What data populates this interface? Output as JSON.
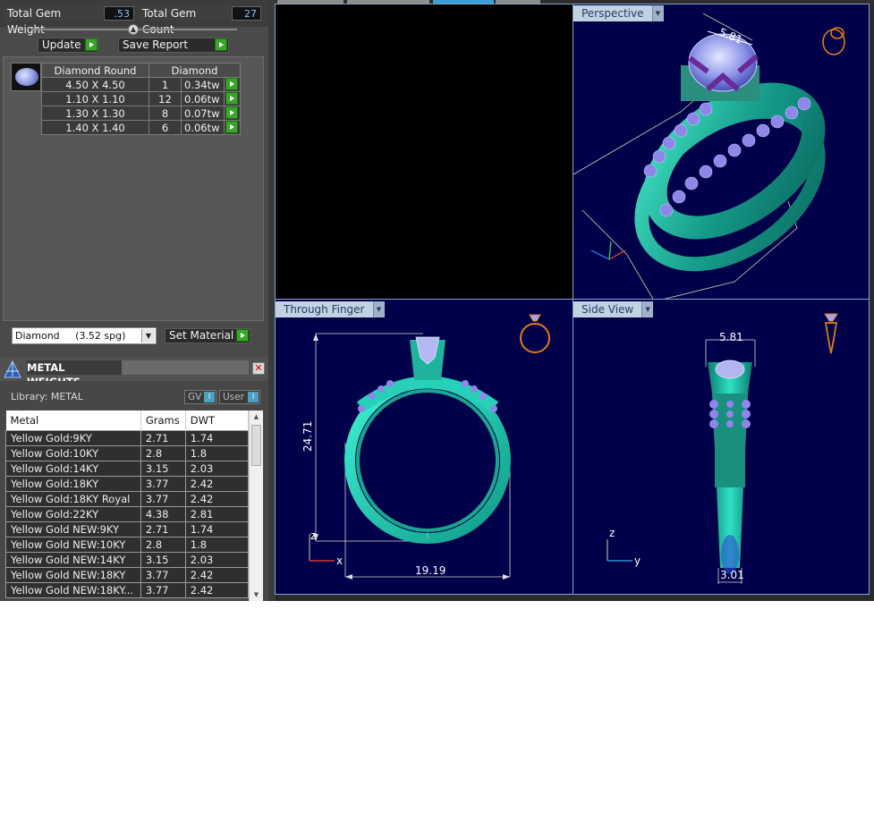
{
  "stats": {
    "total_weight_label": "Total Gem Weight",
    "total_weight_value": ".53",
    "total_count_label": "Total Gem Count",
    "total_count_value": "27"
  },
  "actions": {
    "update_label": "Update",
    "save_report_label": "Save Report"
  },
  "gem_table": {
    "headers": [
      "Diamond Round",
      "Diamond"
    ],
    "rows": [
      {
        "size": "4.50 X 4.50",
        "count": "1",
        "weight": "0.34tw"
      },
      {
        "size": "1.10 X 1.10",
        "count": "12",
        "weight": "0.06tw"
      },
      {
        "size": "1.30 X 1.30",
        "count": "8",
        "weight": "0.07tw"
      },
      {
        "size": "1.40 X 1.40",
        "count": "6",
        "weight": "0.06tw"
      }
    ]
  },
  "material": {
    "selected": "Diamond     (3.52 spg)",
    "set_label": "Set Material"
  },
  "metal_weights": {
    "title": "METAL WEIGHTS",
    "library_label": "Library: METAL",
    "gv_label": "GV",
    "user_label": "User",
    "columns": [
      "Metal",
      "Grams",
      "DWT"
    ],
    "rows": [
      {
        "metal": "Yellow Gold:9KY",
        "grams": "2.71",
        "dwt": "1.74"
      },
      {
        "metal": "Yellow Gold:10KY",
        "grams": "2.8",
        "dwt": "1.8"
      },
      {
        "metal": "Yellow Gold:14KY",
        "grams": "3.15",
        "dwt": "2.03"
      },
      {
        "metal": "Yellow Gold:18KY",
        "grams": "3.77",
        "dwt": "2.42"
      },
      {
        "metal": "Yellow Gold:18KY Royal",
        "grams": "3.77",
        "dwt": "2.42"
      },
      {
        "metal": "Yellow Gold:22KY",
        "grams": "4.38",
        "dwt": "2.81"
      },
      {
        "metal": "Yellow Gold NEW:9KY",
        "grams": "2.71",
        "dwt": "1.74"
      },
      {
        "metal": "Yellow Gold NEW:10KY",
        "grams": "2.8",
        "dwt": "1.8"
      },
      {
        "metal": "Yellow Gold NEW:14KY",
        "grams": "3.15",
        "dwt": "2.03"
      },
      {
        "metal": "Yellow Gold NEW:18KY",
        "grams": "3.77",
        "dwt": "2.42"
      },
      {
        "metal": "Yellow Gold NEW:18KY...",
        "grams": "3.77",
        "dwt": "2.42"
      }
    ]
  },
  "viewports": {
    "perspective": {
      "label": "Perspective",
      "dim": "5.81"
    },
    "through_finger": {
      "label": "Through Finger",
      "height": "24.71",
      "width": "19.19",
      "axis_z": "z",
      "axis_x": "x"
    },
    "side_view": {
      "label": "Side View",
      "top_width": "5.81",
      "bottom_width": "3.01",
      "axis_z": "z",
      "axis_y": "y"
    }
  },
  "colors": {
    "ring": "#1fb8a0",
    "gems": "#8d86e6",
    "viewport_bg": "#00004a",
    "accent_green": "#3aa52a"
  }
}
